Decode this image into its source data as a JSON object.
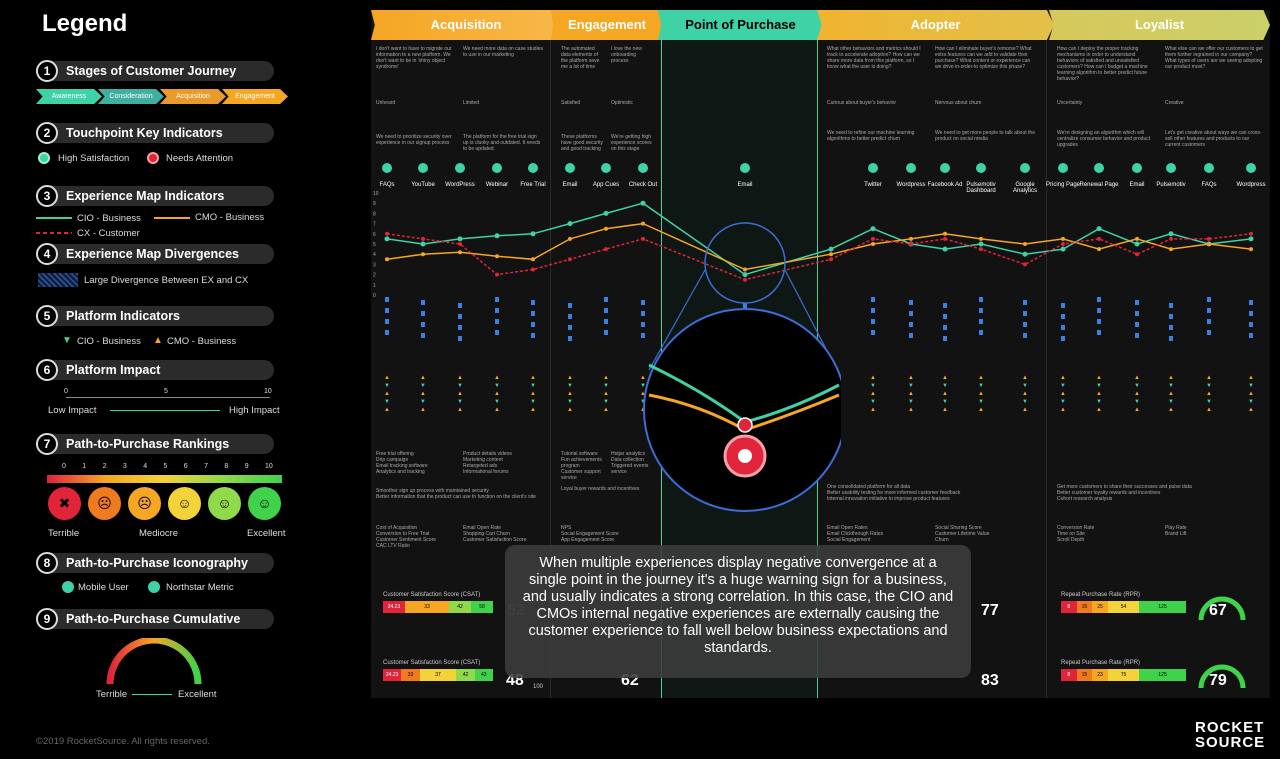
{
  "legend": {
    "title": "Legend",
    "sections": [
      {
        "num": "1",
        "label": "Stages of Customer Journey"
      },
      {
        "num": "2",
        "label": "Touchpoint Key Indicators"
      },
      {
        "num": "3",
        "label": "Experience Map Indicators"
      },
      {
        "num": "4",
        "label": "Experience Map Divergences"
      },
      {
        "num": "5",
        "label": "Platform Indicators"
      },
      {
        "num": "6",
        "label": "Platform Impact"
      },
      {
        "num": "7",
        "label": "Path-to-Purchase Rankings"
      },
      {
        "num": "8",
        "label": "Path-to-Purchase Iconography"
      },
      {
        "num": "9",
        "label": "Path-to-Purchase Cumulative"
      }
    ],
    "stage_chevrons": [
      "Awareness",
      "Consideration",
      "Acquisition",
      "Engagement"
    ],
    "high_satisfaction": "High Satisfaction",
    "needs_attention": "Needs Attention",
    "cio_business": "CIO - Business",
    "cmo_business": "CMO - Business",
    "cx_customer": "CX - Customer",
    "divergence": "Large Divergence Between EX and CX",
    "platform_cio": "CIO - Business",
    "platform_cmo": "CMO - Business",
    "impact_ticks": [
      "0",
      "5",
      "10"
    ],
    "low_impact": "Low Impact",
    "high_impact": "High Impact",
    "ranking_ticks": [
      "0",
      "1",
      "2",
      "3",
      "4",
      "5",
      "6",
      "7",
      "8",
      "9",
      "10"
    ],
    "terrible": "Terrible",
    "mediocre": "Mediocre",
    "excellent": "Excellent",
    "mobile_user": "Mobile User",
    "northstar": "Northstar Metric",
    "cum_terrible": "Terrible",
    "cum_excellent": "Excellent"
  },
  "stages": [
    "Acquisition",
    "Engagement",
    "Point of Purchase",
    "Adopter",
    "Loyalist"
  ],
  "touchpoints": [
    "FAQs",
    "YouTube",
    "WordPress",
    "Webinar",
    "Free Trial",
    "Email",
    "App Cues",
    "Check Out",
    "Email",
    "Twitter",
    "Wordpress",
    "Facebook Ad",
    "Pulsemotiv Dashboard",
    "Google Analytics",
    "Pricing Page",
    "Renewal Page",
    "Email",
    "Pulsemotiv",
    "FAQs",
    "Wordpress"
  ],
  "map_texts": {
    "acq_q1": "I don't want to have to migrate our information to a new platform. We don't want to be in 'shiny object syndrome'",
    "acq_q2": "We need more data on case studies to use in our marketing",
    "eng_q1": "The automated data elements of the platform save me a lot of time",
    "eng_q2": "I love the new onboarding process",
    "adp_q1": "What other behaviors and metrics should I track to accelerate adoption? How can we share more data from this platform, so I know what the user is doing?",
    "adp_q2": "How can I eliminate buyer's remorse? What extra features can we add to validate their purchase? What content or experience can we drive in-order-to optimize this phase?",
    "loy_q1": "How can I deploy the proper tracking mechanisms in order to understand behaviors of satisfied and unsatisfied customers? How can I budget a machine learning algorithm to better predict future behavior?",
    "loy_q2": "What else can we offer our customers to get them further ingrained in our company? What types of users are we seeing adopting our product most?",
    "s_unheard": "Unheard",
    "s_limited": "Limited",
    "s_satisfied": "Satisfied",
    "s_optimistic": "Optimistic",
    "s_curious": "Curious about buyer's behavior",
    "s_nervous": "Nervous about churn",
    "s_uncertainty": "Uncertainty",
    "s_creative": "Creative",
    "acq_c1": "We need to prioritize security over experience in our signup process",
    "acq_c2": "The platform for the free trial sign up is clunky and outdated. It needs to be updated.",
    "eng_c1": "These platforms have good security and good tracking",
    "eng_c2": "We're getting high experience scores on this stage",
    "adp_c1": "We need to refine our machine learning algorithms to better predict churn",
    "adp_c2": "We need to get more people to talk about the product on social media",
    "loy_c1": "We're designing an algorithm which will centralize consumer behavior and product upgrades",
    "loy_c2": "Let's get creative about ways we can cross-sell other features and products to our current customers",
    "acq_b1": "Free trial offering",
    "acq_b2": "Drip campaign",
    "acq_b3": "Email tracking software",
    "acq_b4": "Analytics and tracking",
    "acq_b5": "Product details videos",
    "acq_b6": "Marketing content",
    "acq_b7": "Retargeted ads",
    "acq_b8": "Informational forums",
    "eng_b1": "Tutorial software",
    "eng_b2": "Fun achievements program",
    "eng_b3": "Customer support service",
    "eng_b4": "Hotjar analytics",
    "eng_b5": "Data collection",
    "eng_b6": "Triggered events service",
    "acq_i1": "Smoother sign up process with maintained security",
    "acq_i2": "Better information that the product can use to function on the client's site",
    "eng_i1": "Loyal buyer rewards and incentives",
    "adp_i1": "One consolidated platform for all data",
    "adp_i2": "Better usability testing for more informed customer feedback",
    "adp_i3": "Internal innovation initiative to improve product features",
    "loy_i1": "Get more customers to share their successes and pulse data",
    "loy_i2": "Better customer loyalty rewards and incentives",
    "loy_i3": "Cohort research analysis",
    "acq_m1": "Cost of Acquisition",
    "acq_m2": "Conversion to Free Trial",
    "acq_m3": "Customer Sentiment Score",
    "acq_m4": "CAC LTV Ratio",
    "acq_m5": "Email Open Rate",
    "acq_m6": "Shopping Cart Churn",
    "acq_m7": "Customer Satisfaction Score",
    "eng_m1": "NPS",
    "eng_m2": "Social Engagement Score",
    "eng_m3": "App Engagement Score",
    "adp_m1": "Email Open Rates",
    "adp_m2": "Email Clickthrough Rates",
    "adp_m3": "Social Engagement",
    "adp_m4": "Social Sharing Score",
    "adp_m5": "Customer Lifetime Value",
    "adp_m6": "Churn",
    "loy_m1": "Conversion Rate",
    "loy_m2": "Time on Site",
    "loy_m3": "Scroll Depth",
    "loy_m4": "Play Rate",
    "loy_m5": "Brand Lift"
  },
  "scorecards": {
    "csat_label": "Customer Satisfaction Score (CSAT)",
    "rpr_label": "Repeat Purchase Rate (RPR)",
    "bar1": [
      "24.23",
      "33",
      "42",
      "58"
    ],
    "bar2": [
      "24.23",
      "33",
      "37",
      "42",
      "43"
    ],
    "bar3": [
      "8",
      "15",
      "25",
      "54",
      "125"
    ],
    "bar4": [
      "8",
      "15",
      "23",
      "75",
      "125"
    ],
    "g1": "52",
    "g2": "48",
    "g3": "62",
    "g4": "77",
    "g5": "83",
    "g6": "67",
    "g7": "79",
    "gmax": "100"
  },
  "tooltip": "When multiple experiences display negative convergence at a single point in the journey it's a huge warning sign for a business, and usually indicates a strong correlation. In this case, the CIO and CMOs internal negative experiences are externally causing the customer experience to fall well below business expectations and standards.",
  "footer": "©2019 RocketSource. All rights reserved.",
  "brand_line1": "ROCKET",
  "brand_line2": "SOURCE",
  "y_ticks": [
    "10",
    "9",
    "8",
    "7",
    "6",
    "5",
    "4",
    "3",
    "2",
    "1",
    "0"
  ],
  "colors": {
    "cio": "#3fd2a6",
    "cmo": "#f6a623",
    "cx": "#e0243a",
    "acq": "#f5a623",
    "eng": "#f5a623",
    "pop": "#3fd2a6",
    "adp": "#f0b430",
    "loy": "#d6c85a"
  },
  "chart_data": {
    "type": "line",
    "x": [
      "FAQs",
      "YouTube",
      "WordPress",
      "Webinar",
      "Free Trial",
      "Email",
      "App Cues",
      "Check Out",
      "Point of Purchase",
      "Email",
      "Twitter",
      "Wordpress",
      "Facebook Ad",
      "Pulsemotiv Dashboard",
      "Google Analytics",
      "Pricing Page",
      "Renewal Page",
      "Email",
      "Pulsemotiv",
      "FAQs",
      "Wordpress"
    ],
    "ylim": [
      0,
      10
    ],
    "series": [
      {
        "name": "CIO - Business",
        "values": [
          5.5,
          5.0,
          5.5,
          5.8,
          6.0,
          7.0,
          8.0,
          9.0,
          2.0,
          4.5,
          6.5,
          5.0,
          4.5,
          5.0,
          4.0,
          4.5,
          6.5,
          5.0,
          6.0,
          5.0,
          5.5
        ]
      },
      {
        "name": "CMO - Business",
        "values": [
          3.5,
          4.0,
          4.2,
          3.8,
          3.5,
          5.5,
          6.5,
          7.0,
          2.5,
          4.0,
          5.0,
          5.5,
          6.0,
          5.5,
          5.0,
          5.5,
          4.5,
          5.5,
          4.5,
          5.0,
          4.5
        ]
      },
      {
        "name": "CX - Customer",
        "values": [
          6.0,
          5.5,
          5.0,
          2.0,
          2.5,
          3.5,
          4.5,
          5.5,
          1.5,
          3.5,
          5.5,
          5.0,
          5.5,
          4.5,
          3.0,
          5.0,
          5.5,
          4.0,
          5.5,
          5.5,
          6.0
        ]
      }
    ]
  }
}
